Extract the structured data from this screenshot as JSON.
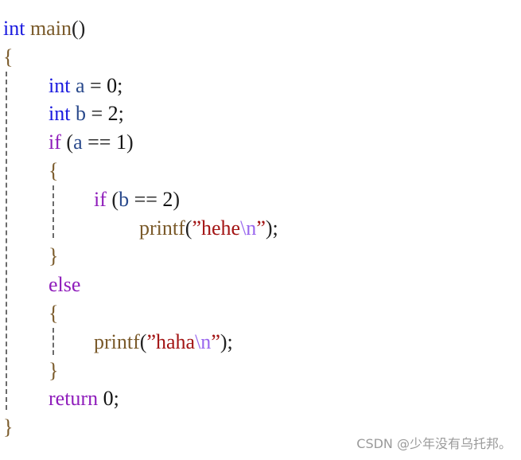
{
  "code": {
    "lines": [
      {
        "tokens": [
          {
            "t": "int",
            "c": "kw-type"
          },
          {
            "t": " ",
            "c": "op"
          },
          {
            "t": "main",
            "c": "fn"
          },
          {
            "t": "()",
            "c": "punct"
          }
        ],
        "indent": 0
      },
      {
        "tokens": [
          {
            "t": "{",
            "c": "brace"
          }
        ],
        "indent": 0
      },
      {
        "tokens": [
          {
            "t": "int",
            "c": "kw-type"
          },
          {
            "t": " ",
            "c": "op"
          },
          {
            "t": "a",
            "c": "var"
          },
          {
            "t": " = ",
            "c": "op"
          },
          {
            "t": "0",
            "c": "num"
          },
          {
            "t": ";",
            "c": "punct"
          }
        ],
        "indent": 1
      },
      {
        "tokens": [
          {
            "t": "int",
            "c": "kw-type"
          },
          {
            "t": " ",
            "c": "op"
          },
          {
            "t": "b",
            "c": "var"
          },
          {
            "t": " = ",
            "c": "op"
          },
          {
            "t": "2",
            "c": "num"
          },
          {
            "t": ";",
            "c": "punct"
          }
        ],
        "indent": 1
      },
      {
        "tokens": [
          {
            "t": "if",
            "c": "kw-ctrl"
          },
          {
            "t": " (",
            "c": "punct"
          },
          {
            "t": "a",
            "c": "var"
          },
          {
            "t": " == ",
            "c": "op"
          },
          {
            "t": "1",
            "c": "num"
          },
          {
            "t": ")",
            "c": "punct"
          }
        ],
        "indent": 1
      },
      {
        "tokens": [
          {
            "t": "{",
            "c": "brace"
          }
        ],
        "indent": 1
      },
      {
        "tokens": [
          {
            "t": "if",
            "c": "kw-ctrl"
          },
          {
            "t": " (",
            "c": "punct"
          },
          {
            "t": "b",
            "c": "var"
          },
          {
            "t": " == ",
            "c": "op"
          },
          {
            "t": "2",
            "c": "num"
          },
          {
            "t": ")",
            "c": "punct"
          }
        ],
        "indent": 2
      },
      {
        "tokens": [
          {
            "t": "printf",
            "c": "fn"
          },
          {
            "t": "(",
            "c": "punct"
          },
          {
            "t": "”",
            "c": "str"
          },
          {
            "t": "hehe",
            "c": "str"
          },
          {
            "t": "\\n",
            "c": "esc"
          },
          {
            "t": "”",
            "c": "str"
          },
          {
            "t": ");",
            "c": "punct"
          }
        ],
        "indent": 3
      },
      {
        "tokens": [
          {
            "t": "}",
            "c": "brace"
          }
        ],
        "indent": 1
      },
      {
        "tokens": [
          {
            "t": "else",
            "c": "kw-ctrl"
          }
        ],
        "indent": 1
      },
      {
        "tokens": [
          {
            "t": "{",
            "c": "brace"
          }
        ],
        "indent": 1
      },
      {
        "tokens": [
          {
            "t": "printf",
            "c": "fn"
          },
          {
            "t": "(",
            "c": "punct"
          },
          {
            "t": "”",
            "c": "str"
          },
          {
            "t": "haha",
            "c": "str"
          },
          {
            "t": "\\n",
            "c": "esc"
          },
          {
            "t": "”",
            "c": "str"
          },
          {
            "t": ");",
            "c": "punct"
          }
        ],
        "indent": 2
      },
      {
        "tokens": [
          {
            "t": "}",
            "c": "brace"
          }
        ],
        "indent": 1
      },
      {
        "tokens": [
          {
            "t": "return",
            "c": "kw-ctrl"
          },
          {
            "t": " ",
            "c": "op"
          },
          {
            "t": "0",
            "c": "num"
          },
          {
            "t": ";",
            "c": "punct"
          }
        ],
        "indent": 1
      },
      {
        "tokens": [
          {
            "t": "}",
            "c": "brace"
          }
        ],
        "indent": 0
      }
    ]
  },
  "watermark": "CSDN @少年没有乌托邦。"
}
